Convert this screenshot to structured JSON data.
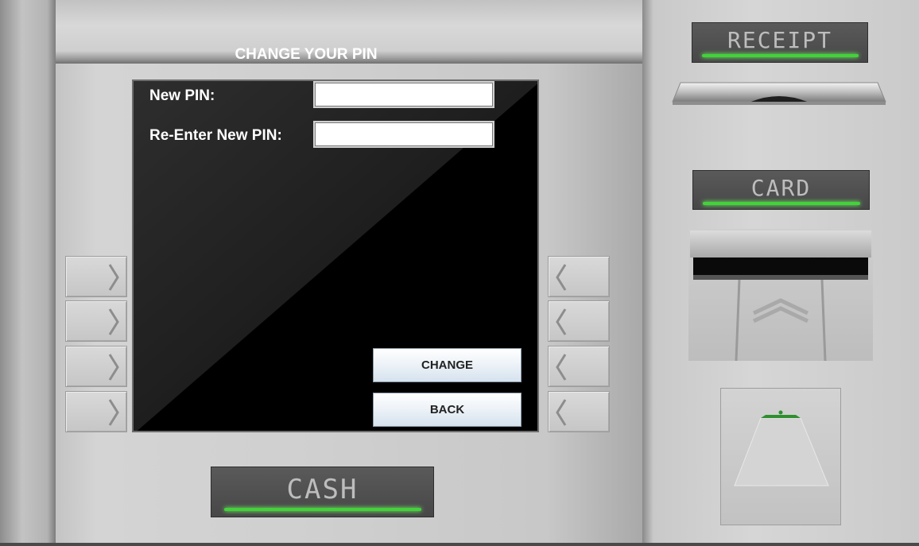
{
  "screen": {
    "title": "CHANGE YOUR PIN",
    "fields": {
      "new_pin": {
        "label": "New PIN:",
        "value": ""
      },
      "reenter_pin": {
        "label": "Re-Enter New PIN:",
        "value": ""
      }
    },
    "buttons": {
      "change": "CHANGE",
      "back": "BACK"
    }
  },
  "panels": {
    "receipt": "RECEIPT",
    "card": "CARD",
    "cash": "CASH"
  },
  "side_keys": {
    "left": [
      "chevron-right-icon",
      "chevron-right-icon",
      "chevron-right-icon",
      "chevron-right-icon"
    ],
    "right": [
      "chevron-left-icon",
      "chevron-left-icon",
      "chevron-left-icon",
      "chevron-left-icon"
    ]
  },
  "colors": {
    "indicator_green": "#42d23a",
    "screen_bg": "#000000",
    "panel_bg": "#4f4f4f"
  }
}
